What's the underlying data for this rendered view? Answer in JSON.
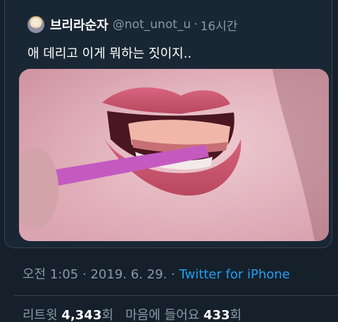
{
  "tweet": {
    "display_name": "브리라순자",
    "handle": "@not_unot_u",
    "separator": "·",
    "time_ago": "16시간",
    "text": "애 데리고 이게 뭐하는 짓이지..",
    "media_icon": "photo"
  },
  "meta": {
    "time": "오전 1:05",
    "sep1": "·",
    "date": "2019. 6. 29.",
    "sep2": "·",
    "source": "Twitter for iPhone"
  },
  "stats": {
    "retweets_label": "리트윗",
    "retweets_count": "4,343",
    "retweets_suffix": "회",
    "likes_label": "마음에 들어요",
    "likes_count": "433",
    "likes_suffix": "회"
  },
  "colors": {
    "background": "#15202b",
    "accent": "#1da1f2",
    "secondary_text": "#8899a6"
  }
}
